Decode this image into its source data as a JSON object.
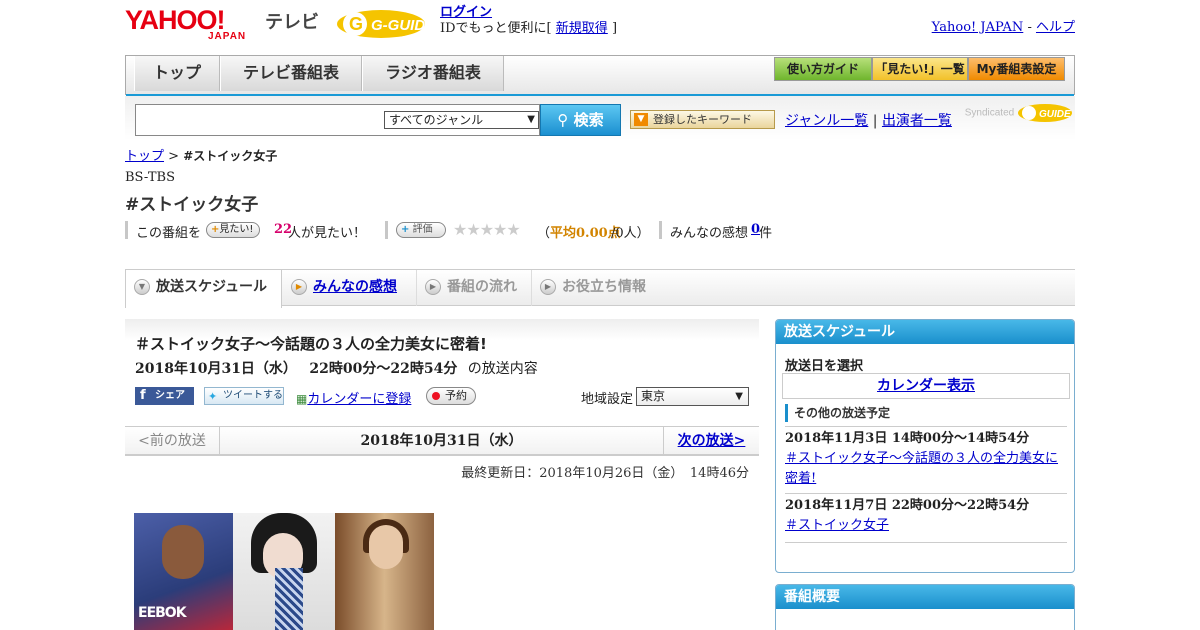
{
  "header": {
    "logo_yahoo": "YAHOO!",
    "logo_japan": "JAPAN",
    "logo_tv": "テレビ",
    "logo_gguide": "G-GUIDE",
    "login_link": "ログイン",
    "login_sub_prefix": "IDでもっと便利に[",
    "signup_link": "新規取得",
    "login_sub_suffix": "]",
    "yahoo_japan_link": "Yahoo! JAPAN",
    "separator": "-",
    "help_link": "ヘルプ"
  },
  "nav": {
    "tabs": [
      "トップ",
      "テレビ番組表",
      "ラジオ番組表"
    ],
    "right_buttons": [
      "使い方ガイド",
      "「見たい!」一覧",
      "My番組表設定"
    ]
  },
  "search": {
    "genre_select": "すべてのジャンル",
    "search_button": "検索",
    "keyword_button": "登録したキーワード",
    "genre_list_link": "ジャンル一覧",
    "divider": "|",
    "cast_list_link": "出演者一覧",
    "syndicated": "Syndicated"
  },
  "breadcrumb": {
    "top": "トップ",
    "sep": ">",
    "current": "#ストイック女子"
  },
  "program": {
    "channel": "BS-TBS",
    "title": "#ストイック女子",
    "mitai_prefix": "この番組を",
    "mitai_button": "見たい!",
    "mitai_count": "22",
    "mitai_suffix": "人が見たい！",
    "rate_button": "評価",
    "stars": "★★★★★",
    "avg_open": "（",
    "avg_label": "平均0.00点",
    "avg_people": "/0人）",
    "impressions_label": "みんなの感想",
    "impressions_count": "0",
    "impressions_suffix": "件"
  },
  "tabs": [
    "放送スケジュール",
    "みんなの感想",
    "番組の流れ",
    "お役立ち情報"
  ],
  "episode": {
    "title": "＃ストイック女子～今話題の３人の全力美女に密着!",
    "date": "2018年10月31日（水）",
    "time": "22時00分～22時54分",
    "content_suffix": "の放送内容",
    "share_fb": "シェア",
    "share_tw": "ツイートする",
    "calendar_link": "カレンダーに登録",
    "reserve_button": "予約",
    "region_label": "地域設定",
    "region_value": "東京",
    "prev": "<前の放送",
    "current_date": "2018年10月31日（水）",
    "next": "次の放送>",
    "updated": "最終更新日：2018年10月26日（金）　14時46分",
    "thumb_text": "EEBOK"
  },
  "schedule": {
    "header": "放送スケジュール",
    "select_label": "放送日を選択",
    "calendar_button": "カレンダー表示",
    "other_label": "その他の放送予定",
    "items": [
      {
        "dt": "2018年11月3日  14時00分～14時54分",
        "link": "＃ストイック女子～今話題の３人の全力美女に密着!"
      },
      {
        "dt": "2018年11月7日  22時00分～22時54分",
        "link": "＃ストイック女子"
      }
    ]
  },
  "overview": {
    "header": "番組概要"
  }
}
